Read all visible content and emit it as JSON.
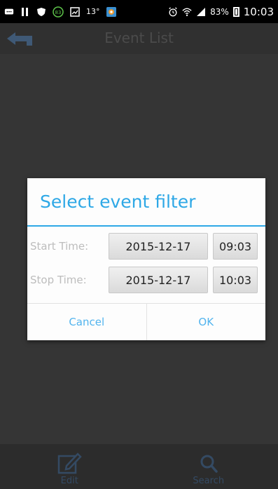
{
  "status_bar": {
    "notif_badge": "83",
    "temperature": "13°",
    "battery": "83%",
    "time": "10:03"
  },
  "app_bar": {
    "title": "Event List"
  },
  "dialog": {
    "title": "Select event filter",
    "start": {
      "label": "Start Time:",
      "date": "2015-12-17",
      "time": "09:03"
    },
    "stop": {
      "label": "Stop Time:",
      "date": "2015-12-17",
      "time": "10:03"
    },
    "cancel": "Cancel",
    "ok": "OK"
  },
  "bottom_bar": {
    "edit_label": "Edit",
    "search_label": "Search"
  },
  "colors": {
    "accent": "#2ea8e6",
    "app_bar": "#303030",
    "background": "#353535",
    "icon_dim": "#344a63"
  }
}
